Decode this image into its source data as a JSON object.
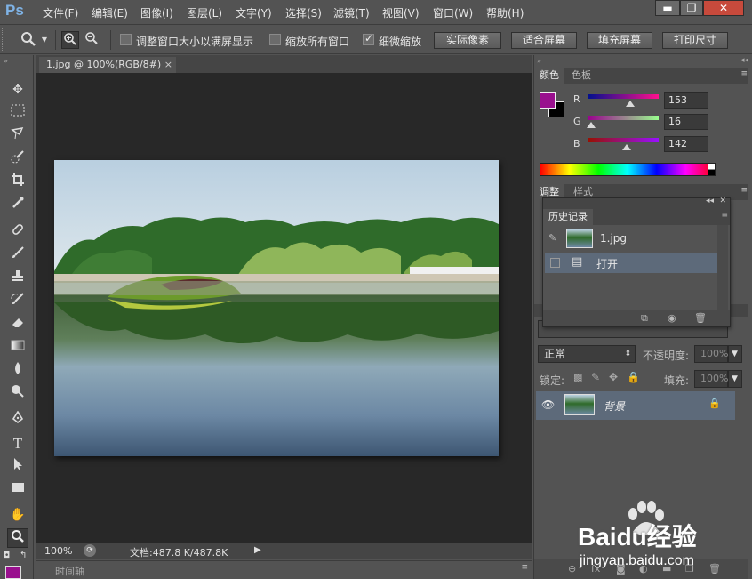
{
  "app": {
    "logo": "Ps"
  },
  "menu": [
    "文件(F)",
    "编辑(E)",
    "图像(I)",
    "图层(L)",
    "文字(Y)",
    "选择(S)",
    "滤镜(T)",
    "视图(V)",
    "窗口(W)",
    "帮助(H)"
  ],
  "window_controls": {
    "minimize": "▬",
    "maximize": "❐",
    "close": "✕"
  },
  "options": {
    "resize_windows_label": "调整窗口大小以满屏显示",
    "zoom_all_label": "缩放所有窗口",
    "scrubby_zoom_label": "细微缩放",
    "actual_pixels": "实际像素",
    "fit_screen": "适合屏幕",
    "fill_screen": "填充屏幕",
    "print_size": "打印尺寸"
  },
  "document": {
    "tab_title": "1.jpg @ 100%(RGB/8#)",
    "close": "×"
  },
  "status": {
    "zoom": "100%",
    "doc_size": "文档:487.8 K/487.8K",
    "arrow": "▶"
  },
  "timeline": {
    "label": "时间轴"
  },
  "color_panel": {
    "tabs": [
      "颜色",
      "色板"
    ],
    "r_label": "R",
    "g_label": "G",
    "b_label": "B",
    "r": "153",
    "g": "16",
    "b": "142",
    "foreground": "#99108e"
  },
  "adjust_panel": {
    "tabs": [
      "调整",
      "样式"
    ]
  },
  "history": {
    "title": "历史记录",
    "snapshot_name": "1.jpg",
    "step": "打开"
  },
  "layers": {
    "blend_mode": "正常",
    "opacity_label": "不透明度:",
    "opacity": "100%",
    "lock_label": "锁定:",
    "fill_label": "填充:",
    "fill": "100%",
    "layer_name": "背景"
  },
  "watermark": {
    "brand": "Baidu经验",
    "url": "jingyan.baidu.com"
  }
}
